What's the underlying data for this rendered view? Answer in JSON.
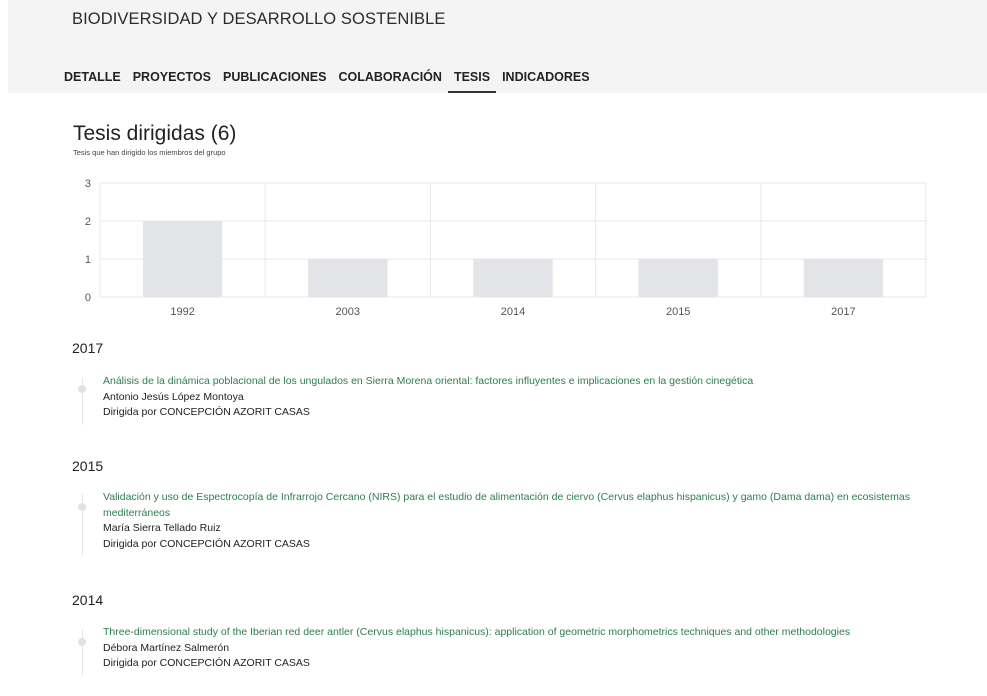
{
  "header": {
    "group_title": "BIODIVERSIDAD Y DESARROLLO SOSTENIBLE",
    "tabs": [
      {
        "label": "DETALLE"
      },
      {
        "label": "PROYECTOS"
      },
      {
        "label": "PUBLICACIONES"
      },
      {
        "label": "COLABORACIÓN"
      },
      {
        "label": "TESIS",
        "active": true
      },
      {
        "label": "INDICADORES"
      }
    ]
  },
  "section": {
    "title": "Tesis dirigidas (6)",
    "subtitle": "Tesis que han dirigido los miembros del grupo"
  },
  "chart_data": {
    "type": "bar",
    "categories": [
      "1992",
      "2003",
      "2014",
      "2015",
      "2017"
    ],
    "values": [
      2,
      1,
      1,
      1,
      1
    ],
    "ylim": [
      0,
      3
    ],
    "yticks": [
      "0",
      "1",
      "2",
      "3"
    ],
    "grid": true,
    "bar_color": "#e2e4e8"
  },
  "theses": [
    {
      "year": "2017",
      "title": "Análisis de la dinámica poblacional de los ungulados en Sierra Morena oriental: factores influyentes e implicaciones en la gestión cinegética",
      "author": "Antonio Jesús López Montoya",
      "director": "Dirigida por CONCEPCIÓN AZORIT CASAS"
    },
    {
      "year": "2015",
      "title": "Validación y uso de Espectrocopía de Infrarrojo Cercano (NIRS) para el estudio de alimentación de ciervo (Cervus elaphus hispanicus) y gamo (Dama dama) en ecosistemas mediterráneos",
      "author": "María Sierra Tellado Ruiz",
      "director": "Dirigida por CONCEPCIÓN AZORIT CASAS"
    },
    {
      "year": "2014",
      "title": "Three-dimensional study of the Iberian red deer antler (Cervus elaphus hispanicus): application of geometric morphometrics techniques and other methodologies",
      "author": "Débora Martínez Salmerón",
      "director": "Dirigida por CONCEPCIÓN AZORIT CASAS"
    }
  ],
  "colors": {
    "link": "#2e7d4f",
    "header_bg": "#f4f4f4"
  }
}
